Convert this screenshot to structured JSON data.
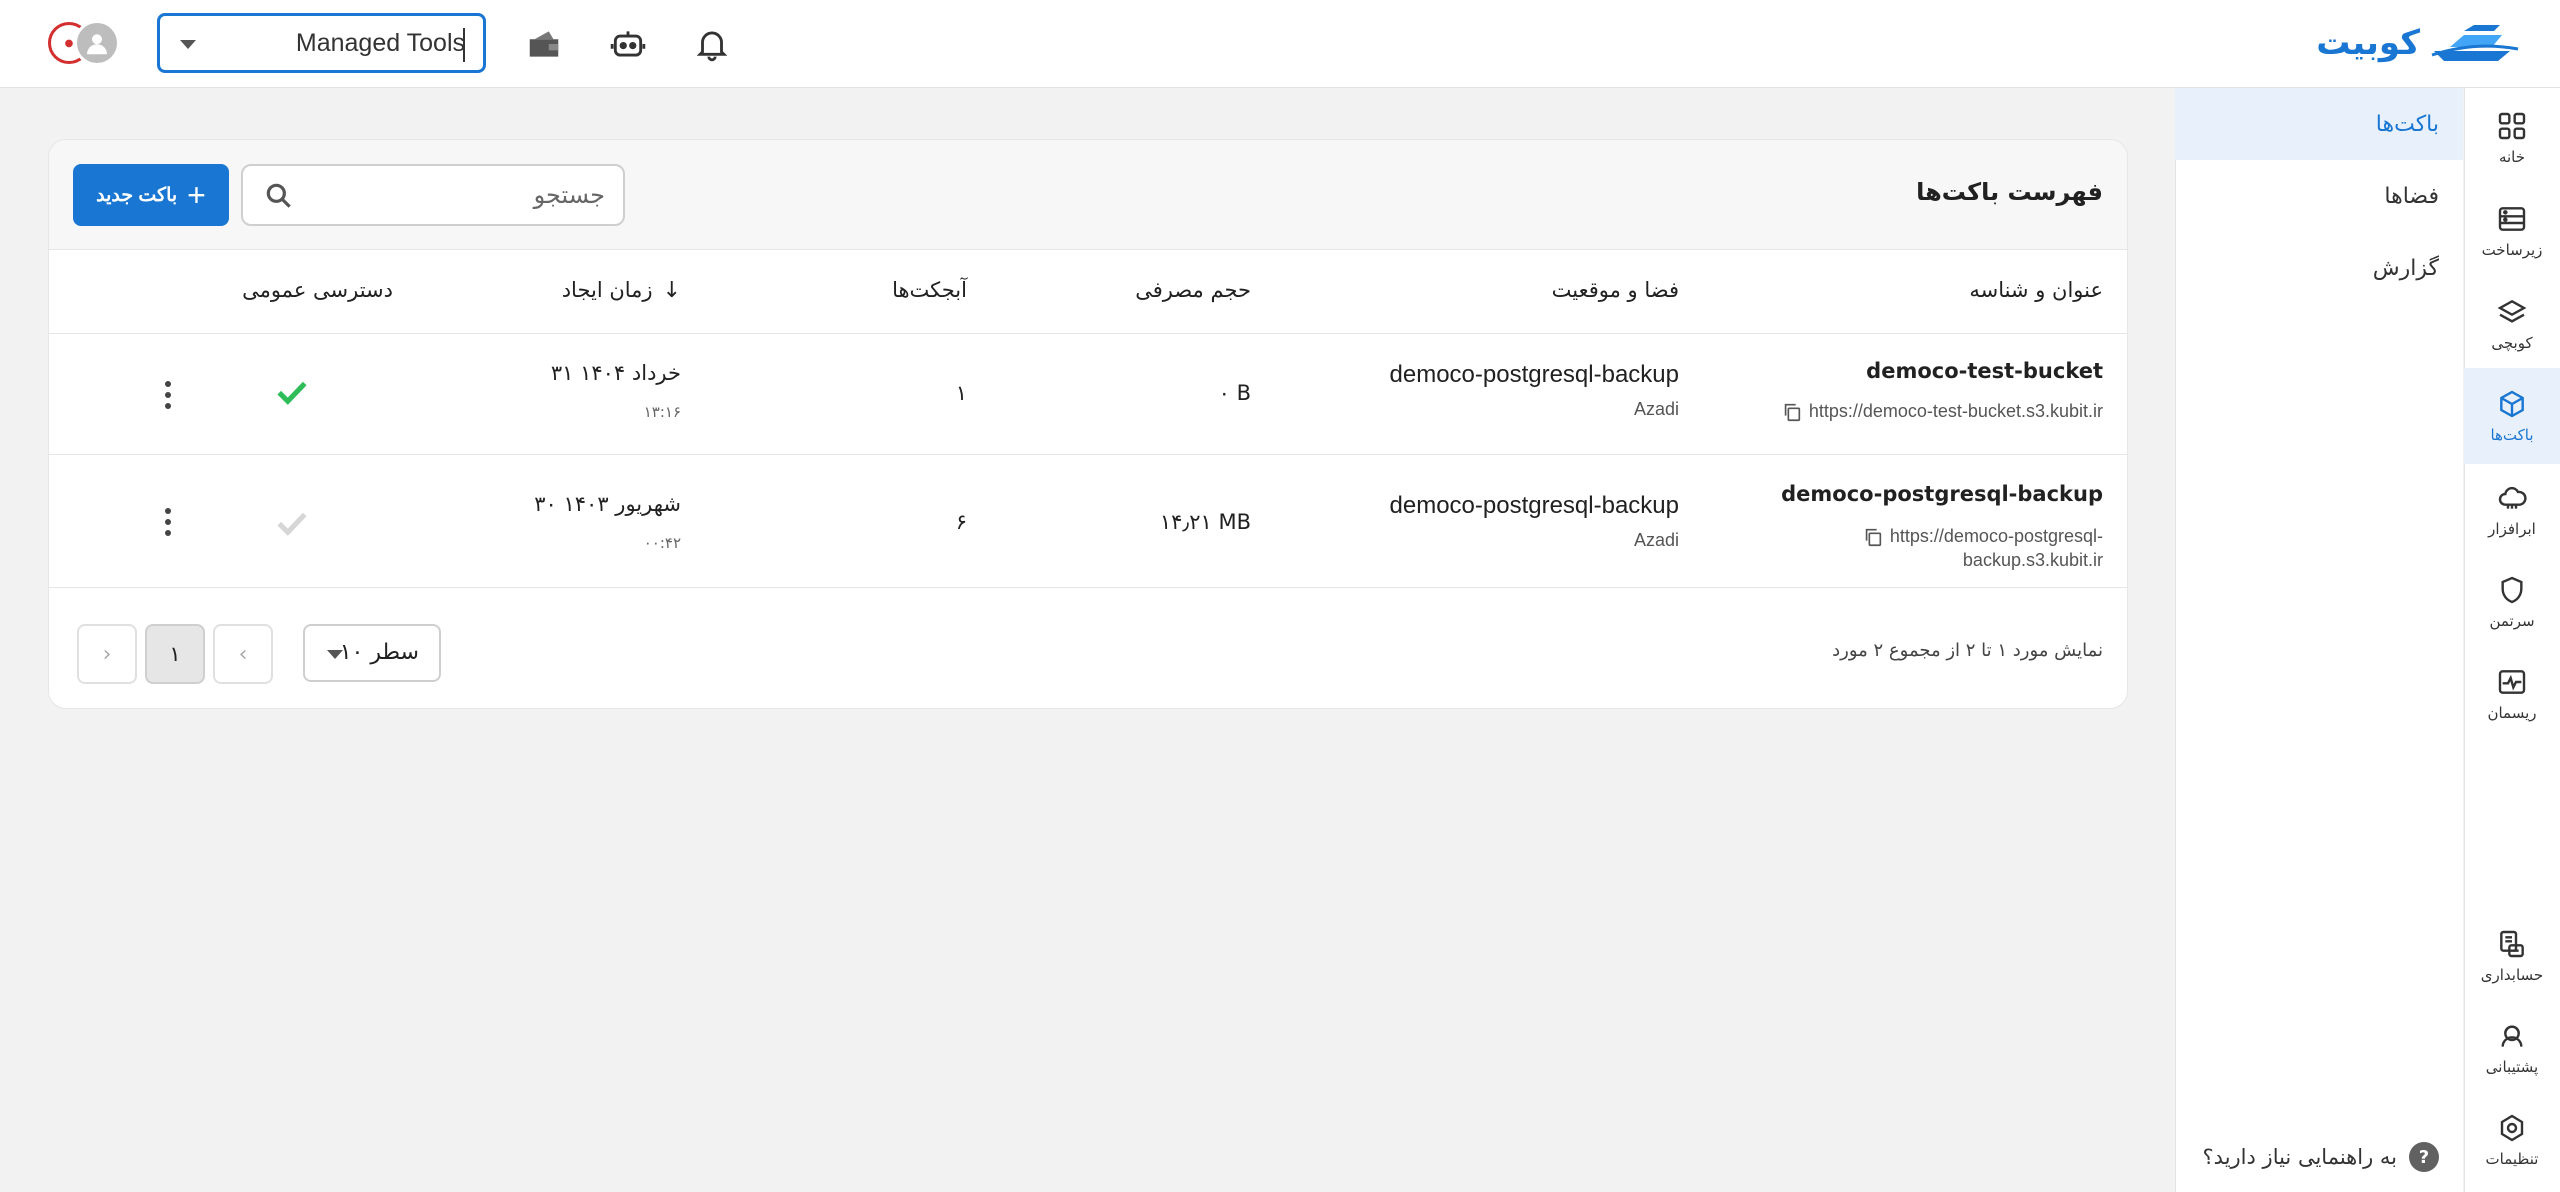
{
  "brand": {
    "name": "کوبیت",
    "color": "#1976d2"
  },
  "header": {
    "tool_select": {
      "value": "Managed Tools"
    },
    "icons": [
      "bell-icon",
      "robot-icon",
      "wallet-icon"
    ]
  },
  "rail": {
    "items": [
      {
        "label": "خانه",
        "icon": "grid-icon"
      },
      {
        "label": "زیرساخت",
        "icon": "server-icon"
      },
      {
        "label": "کوبچی",
        "icon": "layers-icon"
      },
      {
        "label": "باکت‌ها",
        "icon": "cube-icon",
        "active": true
      },
      {
        "label": "ابرافزار",
        "icon": "cloud-icon"
      },
      {
        "label": "سرتمن",
        "icon": "shield-icon"
      },
      {
        "label": "ریسمان",
        "icon": "pulse-icon"
      },
      {
        "label": "حسابداری",
        "icon": "accounting-icon"
      },
      {
        "label": "پشتیبانی",
        "icon": "support-icon"
      },
      {
        "label": "تنظیمات",
        "icon": "settings-icon"
      }
    ]
  },
  "submenu": {
    "items": [
      {
        "label": "باکت‌ها",
        "active": true
      },
      {
        "label": "فضاها"
      },
      {
        "label": "گزارش"
      }
    ],
    "help": "به راهنمایی نیاز دارید؟"
  },
  "card": {
    "title": "فهرست باکت‌ها",
    "search_placeholder": "جستجو",
    "new_button": "باکت جدید",
    "columns": {
      "name": "عنوان و شناسه",
      "space": "فضا و موقعیت",
      "size": "حجم مصرفی",
      "objects": "آبجکت‌ها",
      "created": "زمان ایجاد",
      "public": "دسترسی عمومی"
    },
    "rows": [
      {
        "name": "democo-test-bucket",
        "url": "https://democo-test-bucket.s3.kubit.ir",
        "space": "democo-postgresql-backup",
        "location": "Azadi",
        "size": "۰ B",
        "objects": "۱",
        "date": "۳۱ خرداد ۱۴۰۴",
        "time": "۱۳:۱۶",
        "public": true
      },
      {
        "name": "democo-postgresql-backup",
        "url_line1": "https://democo-postgresql-",
        "url_line2": "backup.s3.kubit.ir",
        "space": "democo-postgresql-backup",
        "location": "Azadi",
        "size": "۱۴٫۲۱ MB",
        "objects": "۶",
        "date": "۳۰ شهریور ۱۴۰۳",
        "time": "۰۰:۴۲",
        "public": false
      }
    ],
    "pager": {
      "info": "نمایش مورد ۱ تا ۲ از مجموع ۲ مورد",
      "rows_per_page": "۱۰ سطر",
      "current_page": "۱"
    },
    "colors": {
      "check_on": "#2ebd59",
      "check_off": "#d6d6d6"
    }
  }
}
